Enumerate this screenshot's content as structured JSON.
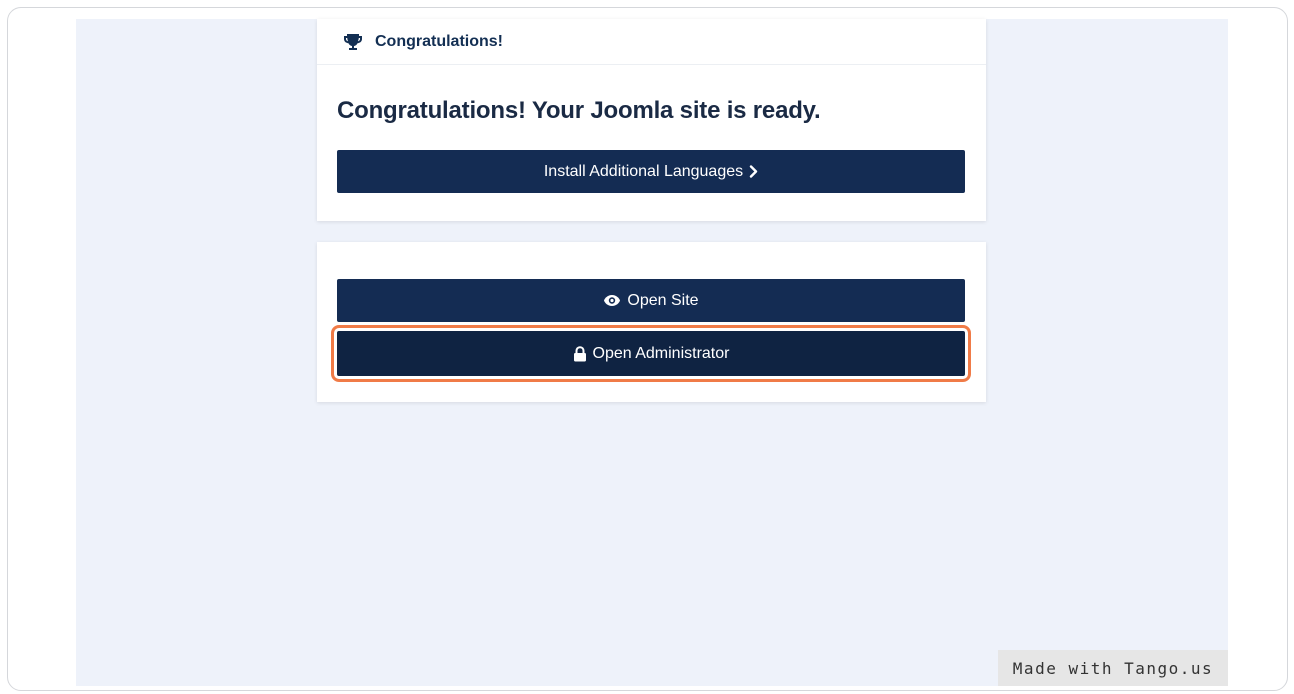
{
  "card_header": {
    "title": "Congratulations!",
    "icon": "trophy-icon"
  },
  "main": {
    "headline": "Congratulations! Your Joomla site is ready.",
    "install_languages_label": "Install Additional Languages",
    "install_languages_icon": "chevron-right-icon"
  },
  "actions": {
    "open_site_label": "Open Site",
    "open_site_icon": "eye-icon",
    "open_admin_label": "Open Administrator",
    "open_admin_icon": "lock-icon"
  },
  "watermark": {
    "text": "Made with Tango.us"
  },
  "colors": {
    "page_background": "#eef2fa",
    "button": "#142c53",
    "highlight": "#f07b47",
    "heading_text": "#1a2a44"
  }
}
